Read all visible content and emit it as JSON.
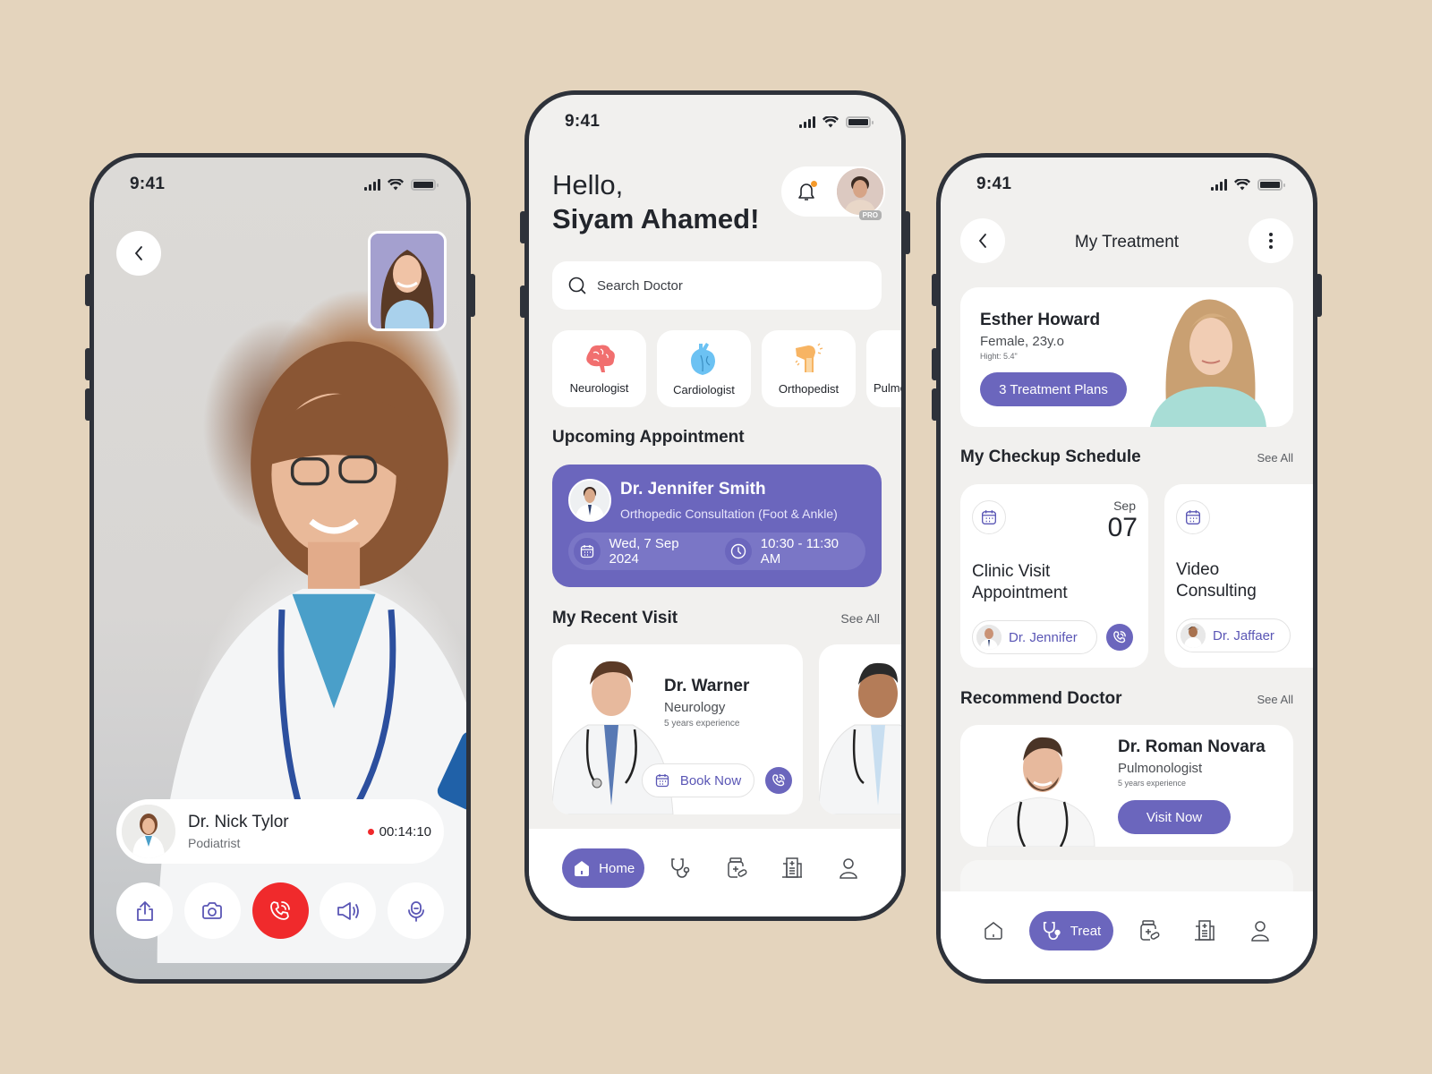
{
  "status_bar": {
    "time": "9:41"
  },
  "theme": {
    "accent": "#6b66bd",
    "danger": "#f02a2c",
    "background": "#e4d4bd",
    "screen": "#f1f0ee"
  },
  "video_call": {
    "back_icon": "chevron-left-icon",
    "self_view": "self-camera-preview",
    "doctor": {
      "name": "Dr. Nick Tylor",
      "role": "Podiatrist"
    },
    "timer": "00:14:10",
    "controls": [
      {
        "name": "share",
        "icon": "share-icon"
      },
      {
        "name": "camera",
        "icon": "camera-icon"
      },
      {
        "name": "end-call",
        "icon": "phone-icon"
      },
      {
        "name": "speaker",
        "icon": "speaker-icon"
      },
      {
        "name": "microphone",
        "icon": "microphone-icon"
      }
    ]
  },
  "home": {
    "greeting_line1": "Hello,",
    "greeting_line2": "Siyam Ahamed!",
    "pro_badge": "PRO",
    "search": {
      "placeholder": "Search Doctor",
      "value": ""
    },
    "categories": [
      {
        "label": "Neurologist",
        "icon": "brain-icon",
        "color": "#f16f6f"
      },
      {
        "label": "Cardiologist",
        "icon": "heart-icon",
        "color": "#6cc2f3"
      },
      {
        "label": "Orthopedist",
        "icon": "knee-icon",
        "color": "#f7b463"
      },
      {
        "label": "Pulmo",
        "icon": "lungs-icon",
        "color": "#6a70dc"
      }
    ],
    "upcoming_title": "Upcoming Appointment",
    "appointment": {
      "doctor": "Dr. Jennifer Smith",
      "type": "Orthopedic Consultation (Foot & Ankle)",
      "date": "Wed, 7 Sep 2024",
      "time": "10:30 - 11:30 AM"
    },
    "recent_title": "My Recent Visit",
    "see_all": "See All",
    "recent_visits": [
      {
        "name": "Dr. Warner",
        "specialty": "Neurology",
        "experience": "5 years experience",
        "book_label": "Book Now"
      }
    ],
    "tabs": [
      {
        "label": "Home",
        "icon": "home-icon",
        "active": true
      },
      {
        "label": "",
        "icon": "stethoscope-icon",
        "active": false
      },
      {
        "label": "",
        "icon": "medicine-icon",
        "active": false
      },
      {
        "label": "",
        "icon": "hospital-icon",
        "active": false
      },
      {
        "label": "",
        "icon": "user-icon",
        "active": false
      }
    ]
  },
  "treatment": {
    "title": "My Treatment",
    "patient": {
      "name": "Esther Howard",
      "info": "Female, 23y.o",
      "height": "Hight: 5.4\"",
      "plans_label": "3 Treatment Plans"
    },
    "schedule_title": "My Checkup Schedule",
    "see_all": "See All",
    "schedule": [
      {
        "month": "Sep",
        "day": "07",
        "title_line1": "Clinic Visit",
        "title_line2": "Appointment",
        "doctor": "Dr. Jennifer"
      },
      {
        "month": "",
        "day": "",
        "title_line1": "Video",
        "title_line2": "Consulting",
        "doctor": "Dr. Jaffaer"
      }
    ],
    "recommend_title": "Recommend  Doctor",
    "recommended": {
      "name": "Dr. Roman Novara",
      "specialty": "Pulmonologist",
      "experience": "5 years experience",
      "visit_label": "Visit Now"
    },
    "tabs": [
      {
        "label": "",
        "icon": "home-icon",
        "active": false
      },
      {
        "label": "Treat",
        "icon": "stethoscope-icon",
        "active": true
      },
      {
        "label": "",
        "icon": "medicine-icon",
        "active": false
      },
      {
        "label": "",
        "icon": "hospital-icon",
        "active": false
      },
      {
        "label": "",
        "icon": "user-icon",
        "active": false
      }
    ]
  }
}
